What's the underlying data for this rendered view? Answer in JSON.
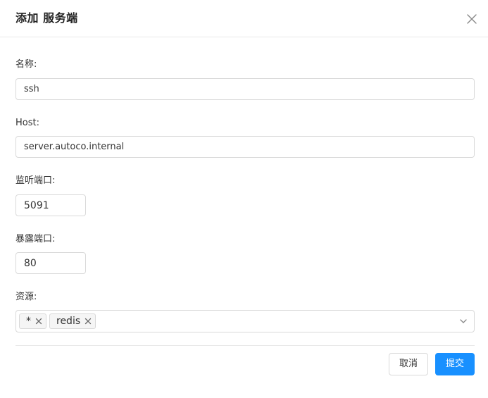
{
  "dialog": {
    "title": "添加 服务端"
  },
  "form": {
    "name_label": "名称:",
    "name_value": "ssh",
    "host_label": "Host:",
    "host_value": "server.autoco.internal",
    "listen_port_label": "监听端口:",
    "listen_port_value": "5091",
    "expose_port_label": "暴露端口:",
    "expose_port_value": "80",
    "resources_label": "资源:",
    "resources_tags": [
      "*",
      "redis"
    ]
  },
  "footer": {
    "cancel_label": "取消",
    "submit_label": "提交"
  },
  "colors": {
    "primary": "#1890ff",
    "border": "#d9d9d9",
    "divider": "#e8e8e8"
  },
  "icons": {
    "close": "close-icon",
    "tag_remove": "close-icon",
    "dropdown": "chevron-down-icon"
  }
}
